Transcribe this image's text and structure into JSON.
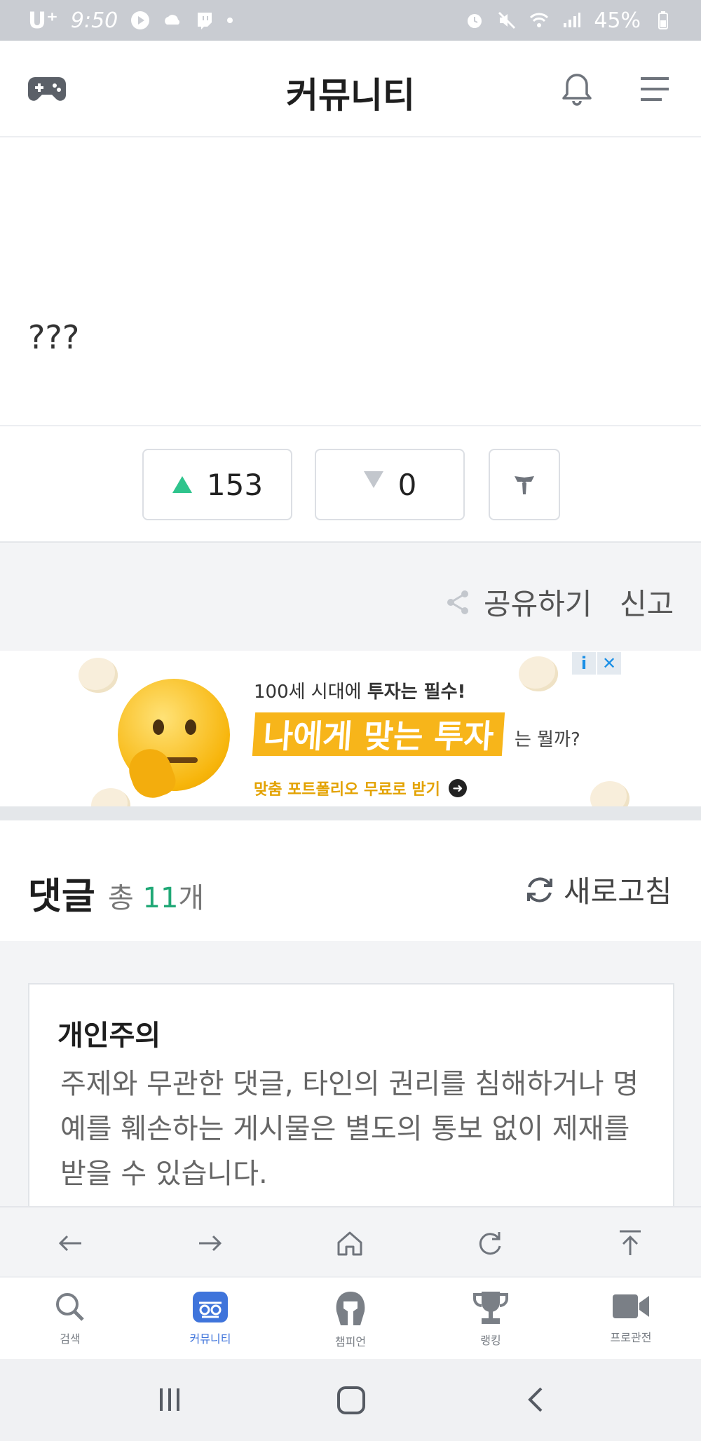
{
  "status_bar": {
    "carrier": "U⁺",
    "time": "9:50",
    "battery": "45%"
  },
  "app_bar": {
    "title": "커뮤니티",
    "icons": [
      "gamepad-icon",
      "bell-icon",
      "menu-icon"
    ]
  },
  "post": {
    "body_text": "???"
  },
  "votes": {
    "up_count": "153",
    "down_count": "0",
    "up_color": "#2fc48d",
    "down_color": "#c3c7cd"
  },
  "actions": {
    "share_label": "공유하기",
    "report_label": "신고"
  },
  "ad": {
    "line1_prefix": "100세 시대에 ",
    "line1_bold": "투자는 필수!",
    "headline": "나에게 맞는 투자",
    "headline_suffix": "는 뭘까?",
    "cta": "맞춤 포트폴리오 무료로 받기",
    "info_glyph": "i",
    "close_glyph": "✕"
  },
  "comments": {
    "heading": "댓글",
    "count_prefix": "총 ",
    "count": "11",
    "count_suffix": "개",
    "refresh_label": "새로고침",
    "accent": "#20a876"
  },
  "notice": {
    "title": "개인주의",
    "body": "주제와 무관한 댓글, 타인의 권리를 침해하거나 명예를 훼손하는 게시물은 별도의 통보 없이 제재를 받을 수 있습니다."
  },
  "browser_nav": {
    "icons": [
      "back-arrow-icon",
      "forward-arrow-icon",
      "home-icon",
      "reload-icon",
      "scroll-top-icon"
    ]
  },
  "tabs": [
    {
      "label": "검색",
      "icon": "search-icon",
      "active": false
    },
    {
      "label": "커뮤니티",
      "icon": "community-icon",
      "active": true
    },
    {
      "label": "챔피언",
      "icon": "helmet-icon",
      "active": false
    },
    {
      "label": "랭킹",
      "icon": "trophy-icon",
      "active": false
    },
    {
      "label": "프로관전",
      "icon": "video-camera-icon",
      "active": false
    }
  ],
  "tab_colors": {
    "active": "#3f74db",
    "inactive": "#7a7f86"
  }
}
